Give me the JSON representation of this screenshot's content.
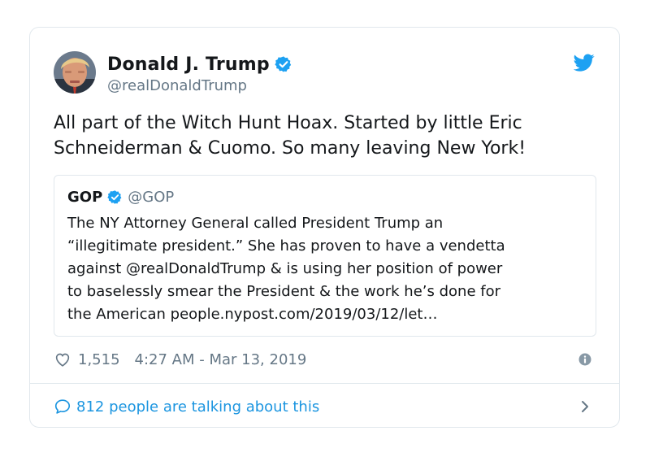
{
  "author": {
    "name": "Donald J. Trump",
    "handle": "@realDonaldTrump"
  },
  "tweet": {
    "line1": "All part of the Witch Hunt Hoax. Started by little Eric",
    "line2": "Schneiderman & Cuomo. So many leaving New York!"
  },
  "quoted": {
    "name": "GOP",
    "handle": "@GOP",
    "lines": [
      "The NY Attorney General called President Trump an",
      "“illegitimate president.” She has proven to have a vendetta",
      "against @realDonaldTrump & is using her position of power",
      "to baselessly smear the President & the work he’s done for",
      "the American people.nypost.com/2019/03/12/let…"
    ]
  },
  "meta": {
    "likes": "1,515",
    "timestamp": "4:27 AM - Mar 13, 2019"
  },
  "footer": {
    "talking": "812 people are talking about this"
  },
  "icons": {
    "verified": "verified-badge-icon",
    "twitter": "twitter-bird-icon",
    "like": "heart-icon",
    "info": "info-icon",
    "reply": "speech-bubble-icon",
    "chevron": "chevron-right-icon"
  },
  "colors": {
    "twitter_blue": "#1da1f2",
    "link_blue": "#1b95e0",
    "secondary_text": "#657786",
    "border": "#e1e8ed"
  }
}
